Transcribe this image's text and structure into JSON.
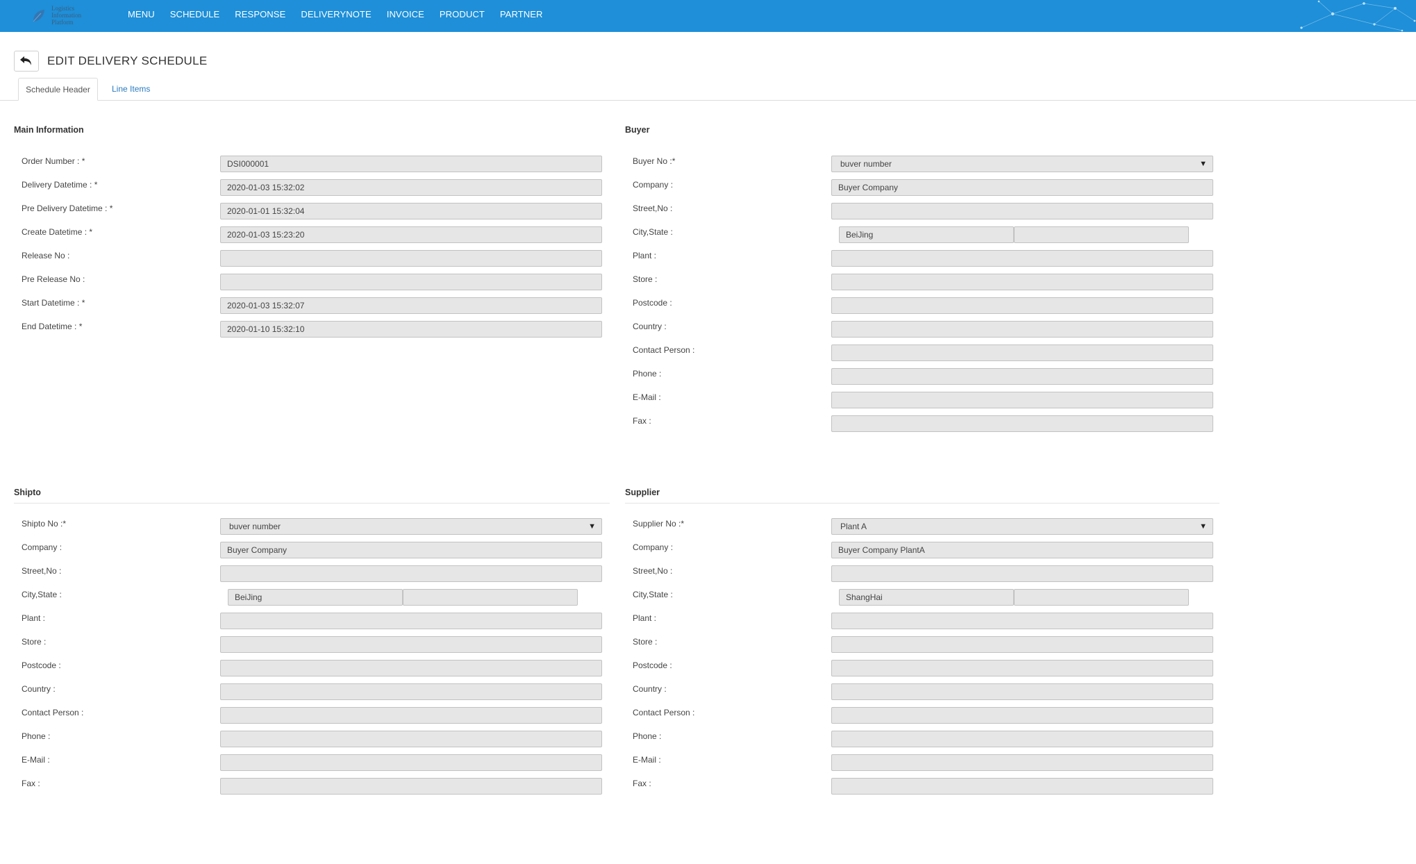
{
  "nav": {
    "logo_text": [
      "Logistics",
      "Information",
      "Platform"
    ],
    "items": [
      "MENU",
      "SCHEDULE",
      "RESPONSE",
      "DELIVERYNOTE",
      "INVOICE",
      "PRODUCT",
      "PARTNER"
    ]
  },
  "header": {
    "title": "EDIT DELIVERY SCHEDULE",
    "back_icon": "undo-arrow-icon"
  },
  "tabs": [
    {
      "label": "Schedule Header",
      "active": true
    },
    {
      "label": "Line Items",
      "active": false
    }
  ],
  "main_info": {
    "title": "Main Information",
    "order_number": {
      "label": "Order Number : *",
      "value": "DSI000001"
    },
    "delivery_datetime": {
      "label": "Delivery Datetime : *",
      "value": "2020-01-03 15:32:02"
    },
    "pre_delivery_datetime": {
      "label": "Pre Delivery Datetime : *",
      "value": "2020-01-01 15:32:04"
    },
    "create_datetime": {
      "label": "Create Datetime : *",
      "value": "2020-01-03 15:23:20"
    },
    "release_no": {
      "label": "Release No :",
      "value": ""
    },
    "pre_release_no": {
      "label": "Pre Release No :",
      "value": ""
    },
    "start_datetime": {
      "label": "Start Datetime : *",
      "value": "2020-01-03 15:32:07"
    },
    "end_datetime": {
      "label": "End Datetime : *",
      "value": "2020-01-10 15:32:10"
    }
  },
  "buyer": {
    "title": "Buyer",
    "no": {
      "label": "Buyer No :*",
      "value": "buver number"
    },
    "company": {
      "label": "Company :",
      "value": "Buyer Company"
    },
    "street": {
      "label": "Street,No :",
      "value": ""
    },
    "city_state": {
      "label": "City,State :",
      "city": "BeiJing",
      "state": ""
    },
    "plant": {
      "label": "Plant :",
      "value": ""
    },
    "store": {
      "label": "Store :",
      "value": ""
    },
    "postcode": {
      "label": "Postcode :",
      "value": ""
    },
    "country": {
      "label": "Country :",
      "value": ""
    },
    "contact": {
      "label": "Contact Person :",
      "value": ""
    },
    "phone": {
      "label": "Phone :",
      "value": ""
    },
    "email": {
      "label": "E-Mail :",
      "value": ""
    },
    "fax": {
      "label": "Fax :",
      "value": ""
    }
  },
  "shipto": {
    "title": "Shipto",
    "no": {
      "label": "Shipto No :*",
      "value": "buver number"
    },
    "company": {
      "label": "Company :",
      "value": "Buyer Company"
    },
    "street": {
      "label": "Street,No :",
      "value": ""
    },
    "city_state": {
      "label": "City,State :",
      "city": "BeiJing",
      "state": ""
    },
    "plant": {
      "label": "Plant :",
      "value": ""
    },
    "store": {
      "label": "Store :",
      "value": ""
    },
    "postcode": {
      "label": "Postcode :",
      "value": ""
    },
    "country": {
      "label": "Country :",
      "value": ""
    },
    "contact": {
      "label": "Contact Person :",
      "value": ""
    },
    "phone": {
      "label": "Phone :",
      "value": ""
    },
    "email": {
      "label": "E-Mail :",
      "value": ""
    },
    "fax": {
      "label": "Fax :",
      "value": ""
    }
  },
  "supplier": {
    "title": "Supplier",
    "no": {
      "label": "Supplier No :*",
      "value": "Plant A"
    },
    "company": {
      "label": "Company :",
      "value": "Buyer Company PlantA"
    },
    "street": {
      "label": "Street,No :",
      "value": ""
    },
    "city_state": {
      "label": "City,State :",
      "city": "ShangHai",
      "state": ""
    },
    "plant": {
      "label": "Plant :",
      "value": ""
    },
    "store": {
      "label": "Store :",
      "value": ""
    },
    "postcode": {
      "label": "Postcode :",
      "value": ""
    },
    "country": {
      "label": "Country :",
      "value": ""
    },
    "contact": {
      "label": "Contact Person :",
      "value": ""
    },
    "phone": {
      "label": "Phone :",
      "value": ""
    },
    "email": {
      "label": "E-Mail :",
      "value": ""
    },
    "fax": {
      "label": "Fax :",
      "value": ""
    }
  },
  "colors": {
    "topbar": "#1e8fd8",
    "field_bg": "#e6e6e6",
    "link": "#2a7bc0"
  }
}
